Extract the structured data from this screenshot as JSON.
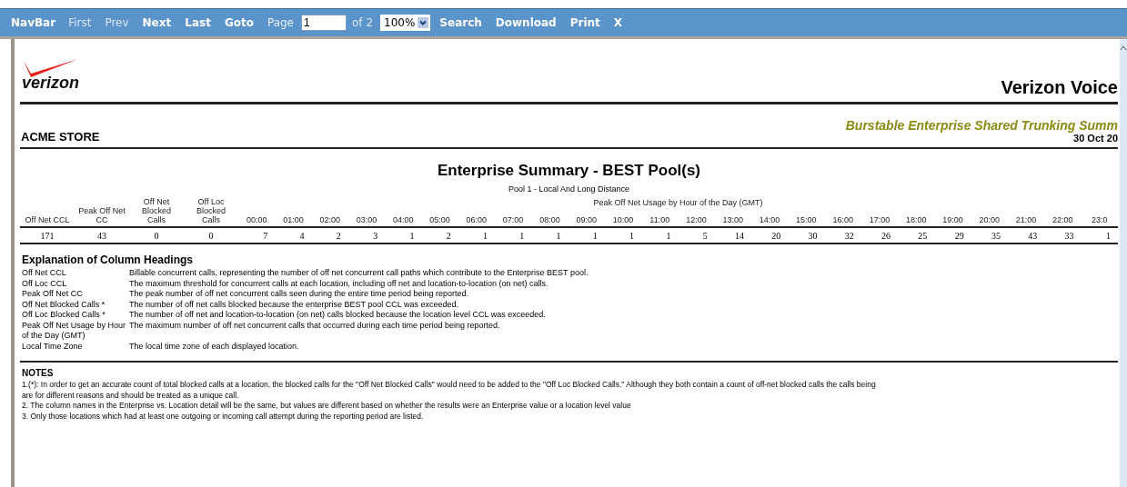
{
  "navbar": {
    "title": "NavBar",
    "items": [
      {
        "kind": "button",
        "label": "First",
        "disabled": true
      },
      {
        "kind": "button",
        "label": "Prev",
        "disabled": true
      },
      {
        "kind": "button",
        "label": "Next",
        "disabled": false
      },
      {
        "kind": "button",
        "label": "Last",
        "disabled": false
      },
      {
        "kind": "button",
        "label": "Goto",
        "disabled": false
      },
      {
        "kind": "label",
        "label": "Page",
        "disabled": false
      },
      {
        "kind": "input",
        "value": "1",
        "disabled": false
      },
      {
        "kind": "label",
        "label": "of 2",
        "disabled": true
      },
      {
        "kind": "select",
        "value": "100%",
        "disabled": false
      },
      {
        "kind": "button",
        "label": "Search",
        "disabled": false
      },
      {
        "kind": "button",
        "label": "Download",
        "disabled": false
      },
      {
        "kind": "button",
        "label": "Print",
        "disabled": false
      },
      {
        "kind": "button",
        "label": "X",
        "disabled": false
      }
    ]
  },
  "report": {
    "logo_text": "verizon",
    "title": "Verizon Voice",
    "customer": "ACME STORE",
    "subtitle": "Burstable Enterprise Shared Trunking Summ",
    "date": "30 Oct 20",
    "section_title": "Enterprise Summary - BEST Pool(s)",
    "pool": "Pool 1 - Local And Long Distance",
    "table": {
      "columns": [
        "Off Net CCL",
        "Peak Off Net CC",
        "Off Net Blocked Calls",
        "Off Loc Blocked Calls"
      ],
      "group_heading": "Peak Off Net Usage by Hour of the Day (GMT)",
      "hours": [
        "00:00",
        "01:00",
        "02:00",
        "03:00",
        "04:00",
        "05:00",
        "06:00",
        "07:00",
        "08:00",
        "09:00",
        "10:00",
        "11:00",
        "12:00",
        "13:00",
        "14:00",
        "15:00",
        "16:00",
        "17:00",
        "18:00",
        "19:00",
        "20:00",
        "21:00",
        "22:00",
        "23:0"
      ],
      "values": [
        "171",
        "43",
        "0",
        "0"
      ],
      "hour_values": [
        "7",
        "4",
        "2",
        "3",
        "1",
        "2",
        "1",
        "1",
        "1",
        "1",
        "1",
        "1",
        "5",
        "14",
        "20",
        "30",
        "32",
        "26",
        "25",
        "29",
        "35",
        "43",
        "33",
        "1"
      ]
    },
    "explanation": {
      "title": "Explanation of Column Headings",
      "rows": [
        {
          "term": "Off Net CCL",
          "text": "Billable concurrent calls, representing the number of off net concurrent call paths which contribute to the Enterprise BEST pool."
        },
        {
          "term": "Off Loc CCL",
          "text": "The maximum threshold for concurrent calls at each location, including off net and location-to-location (on net) calls."
        },
        {
          "term": "Peak Off Net CC",
          "text": "The peak number of off net concurrent calls seen during the entire time period being reported."
        },
        {
          "term": "Off Net Blocked Calls *",
          "text": "The number of off net calls blocked because the enterprise BEST pool CCL was exceeded."
        },
        {
          "term": "Off Loc Blocked Calls *",
          "text": "The number of off net and location-to-location (on net) calls blocked because the location level CCL was exceeded."
        },
        {
          "term": "Peak Off Net Usage by Hour of the Day (GMT)",
          "text": "The maximum number of off net concurrent calls that occurred during each time period being reported."
        },
        {
          "term": "Local Time Zone",
          "text": "The local time zone of each displayed location."
        }
      ]
    },
    "notes": {
      "title": "NOTES",
      "items": [
        "1.(*): In order to get an accurate count of total blocked calls at a location, the blocked calls for the \"Off Net Blocked Calls\" would need to be added to the \"Off Loc Blocked Calls.\" Although they both contain a count of off-net blocked calls the calls being",
        "are for different reasons and should be treated as a unique call.",
        "2. The column names in the Enterprise vs. Location detail will be the same, but values are different based on whether the results were an Enterprise value or a location level value",
        "3. Only those locations which had at least one outgoing or incoming call attempt during the reporting period are listed."
      ]
    }
  }
}
